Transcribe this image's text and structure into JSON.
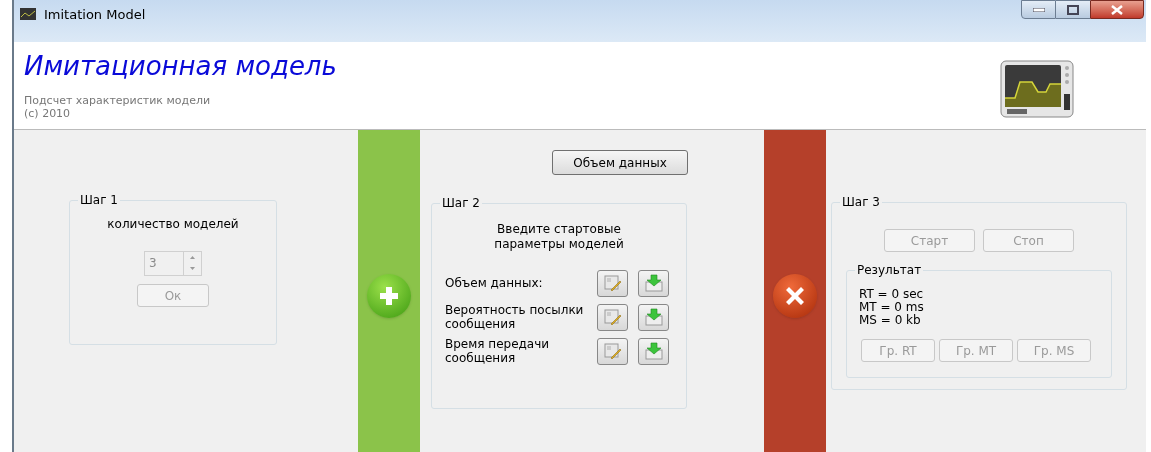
{
  "window": {
    "title": "Imitation Model"
  },
  "header": {
    "title": "Имитационная модель",
    "subtitle": "Подсчет характеристик модели",
    "copyright": "(c) 2010"
  },
  "step1": {
    "legend": "Шаг 1",
    "label": "количество моделей",
    "spinner": {
      "value": "3",
      "disabled": true
    },
    "ok_button": {
      "label": "Ок",
      "disabled": true
    }
  },
  "add_bar": {
    "color": "#8bc34a"
  },
  "step2": {
    "volume_button": "Объем данных",
    "legend": "Шаг 2",
    "intro": "Введите стартовые параметры моделей",
    "params": [
      {
        "label": "Объем данных:"
      },
      {
        "label": "Вероятность посылки сообщения"
      },
      {
        "label": "Время передачи сообщения"
      }
    ]
  },
  "remove_bar": {
    "color": "#b5402a"
  },
  "step3": {
    "legend": "Шаг 3",
    "start_button": {
      "label": "Старт",
      "disabled": true
    },
    "stop_button": {
      "label": "Стоп",
      "disabled": true
    },
    "result": {
      "legend": "Результат",
      "lines": [
        "RT = 0 sec",
        "MT = 0 ms",
        "MS = 0 kb"
      ],
      "graph_buttons": [
        {
          "label": "Гр. RT",
          "disabled": true
        },
        {
          "label": "Гр. MT",
          "disabled": true
        },
        {
          "label": "Гр. MS",
          "disabled": true
        }
      ]
    }
  }
}
